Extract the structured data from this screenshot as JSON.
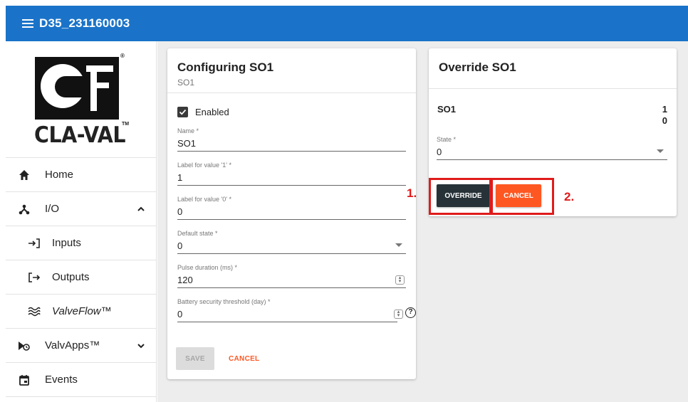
{
  "app": {
    "title": "D35_231160003"
  },
  "logo": {
    "text": "CLA-VAL",
    "registered": "®",
    "trademark": "TM"
  },
  "sidebar": {
    "items": [
      {
        "label": "Home",
        "icon": "home-icon"
      },
      {
        "label": "I/O",
        "icon": "io-tree-icon",
        "expanded": true
      },
      {
        "label": "Inputs",
        "icon": "login-arrow-icon"
      },
      {
        "label": "Outputs",
        "icon": "logout-arrow-icon"
      },
      {
        "label": "ValveFlow™",
        "icon": "waves-icon"
      },
      {
        "label": "ValvApps™",
        "icon": "valve-apps-icon",
        "expanded": false
      },
      {
        "label": "Events",
        "icon": "calendar-icon"
      }
    ]
  },
  "config": {
    "title": "Configuring SO1",
    "subtitle": "SO1",
    "enabled_label": "Enabled",
    "enabled": true,
    "fields": [
      {
        "label": "Name *",
        "value": "SO1"
      },
      {
        "label": "Label for value '1' *",
        "value": "1"
      },
      {
        "label": "Label for value '0' *",
        "value": "0"
      },
      {
        "label": "Default state *",
        "value": "0"
      },
      {
        "label": "Pulse duration (ms) *",
        "value": "120"
      },
      {
        "label": "Battery security threshold (day) *",
        "value": "0"
      }
    ],
    "save_label": "SAVE",
    "cancel_label": "CANCEL"
  },
  "override": {
    "title": "Override SO1",
    "output_name": "SO1",
    "value_1": "1",
    "value_0": "0",
    "state_label": "State *",
    "state_value": "0",
    "override_label": "OVERRIDE",
    "cancel_label": "CANCEL"
  },
  "annotations": {
    "step1": "1.",
    "step2": "2.",
    "color": "#e01b1b"
  },
  "colors": {
    "topbar": "#1a73c8",
    "accent": "#ff5722",
    "dark_button": "#263238"
  }
}
